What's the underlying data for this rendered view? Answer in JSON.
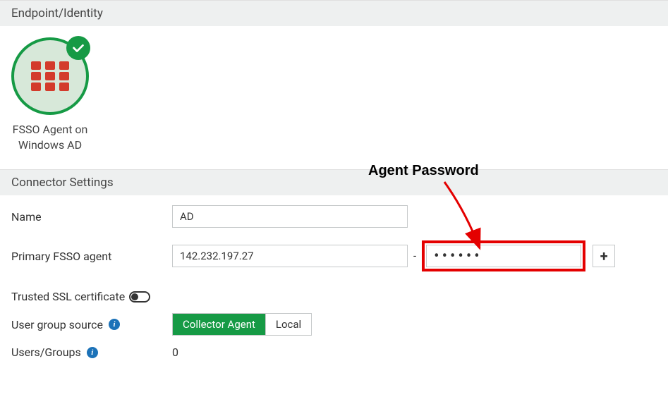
{
  "sections": {
    "endpoint_header": "Endpoint/Identity",
    "connector_header": "Connector Settings"
  },
  "card": {
    "title_line1": "FSSO Agent on",
    "title_line2": "Windows AD"
  },
  "form": {
    "name_label": "Name",
    "name_value": "AD",
    "primary_label": "Primary FSSO agent",
    "primary_ip": "142.232.197.27",
    "primary_password": "••••••",
    "trusted_label": "Trusted SSL certificate",
    "ugs_label": "User group source",
    "ugs_option_collector": "Collector Agent",
    "ugs_option_local": "Local",
    "users_label": "Users/Groups",
    "users_value": "0"
  },
  "annotation": {
    "text": "Agent Password"
  },
  "icons": {
    "plus": "+",
    "info": "i"
  }
}
